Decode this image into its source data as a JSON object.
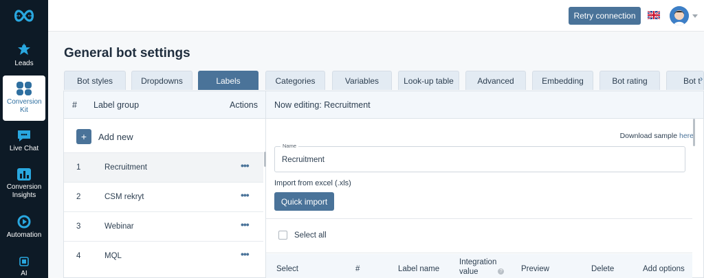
{
  "sidebar": {
    "items": [
      {
        "label": "Leads",
        "icon": "person-star-icon"
      },
      {
        "label": "Conversion Kit",
        "icon": "bubbles-icon"
      },
      {
        "label": "Live Chat",
        "icon": "chat-icon"
      },
      {
        "label": "Conversion Insights",
        "icon": "bar-chart-icon"
      },
      {
        "label": "Automation",
        "icon": "cycle-icon"
      },
      {
        "label": "AI",
        "icon": "chip-icon"
      }
    ]
  },
  "topbar": {
    "retry_label": "Retry connection"
  },
  "page": {
    "title": "General bot settings"
  },
  "tabs": [
    {
      "label": "Bot styles"
    },
    {
      "label": "Dropdowns"
    },
    {
      "label": "Labels"
    },
    {
      "label": "Categories"
    },
    {
      "label": "Variables"
    },
    {
      "label": "Look-up table"
    },
    {
      "label": "Advanced"
    },
    {
      "label": "Embedding"
    },
    {
      "label": "Bot rating"
    },
    {
      "label": "Bot t"
    }
  ],
  "label_groups": {
    "header_num": "#",
    "header_group": "Label group",
    "header_actions": "Actions",
    "add_new": "Add new",
    "rows": [
      {
        "num": "1",
        "name": "Recruitment"
      },
      {
        "num": "2",
        "name": "CSM rekryt"
      },
      {
        "num": "3",
        "name": "Webinar"
      },
      {
        "num": "4",
        "name": "MQL"
      }
    ]
  },
  "editor": {
    "header": "Now editing: Recruitment",
    "download_text": "Download sample",
    "download_link": "here",
    "name_legend": "Name",
    "name_value": "Recruitment",
    "import_label": "Import from excel (.xls)",
    "quick_import": "Quick import",
    "select_all": "Select all",
    "columns": {
      "select": "Select",
      "num": "#",
      "label_name": "Label name",
      "integration_1": "Integration",
      "integration_2": "value",
      "preview": "Preview",
      "delete": "Delete",
      "add_options": "Add options"
    }
  },
  "colors": {
    "sidebar_bg": "#0d1a26",
    "accent": "#4a7399",
    "panel_header": "#f3f7fb"
  }
}
